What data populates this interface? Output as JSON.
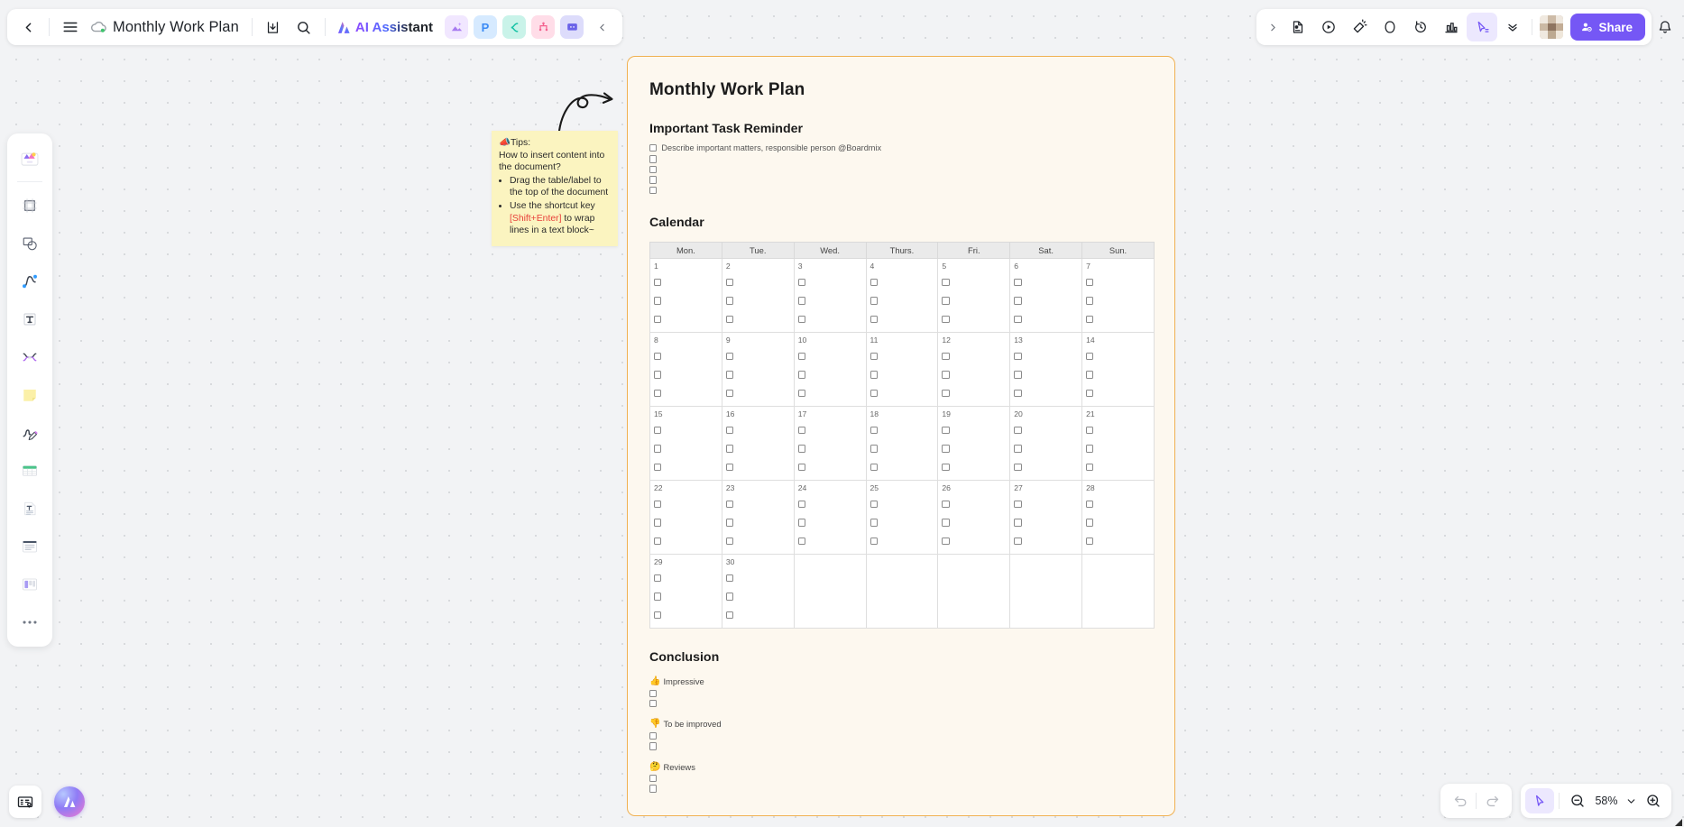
{
  "app": {
    "document_title": "Monthly Work Plan",
    "back_label": "Back",
    "menu_label": "Menu",
    "ai_assistant_label": "AI Assistant",
    "share_label": "Share",
    "app_icons": [
      {
        "name": "ai-image-icon",
        "glyph": "▲",
        "color": "#f0e6ff",
        "fg": "#9b6bf2"
      },
      {
        "name": "ppt-icon",
        "glyph": "P",
        "color": "#d9ecff",
        "fg": "#3b8bf5"
      },
      {
        "name": "mindmap-icon",
        "glyph": "C",
        "color": "#cdf5ec",
        "fg": "#19c2a6"
      },
      {
        "name": "flowchart-icon",
        "glyph": "ᛉ",
        "color": "#ffdfe8",
        "fg": "#f4628f"
      },
      {
        "name": "comment-icon",
        "glyph": "▤",
        "color": "#dcdcfb",
        "fg": "#6a62e8"
      }
    ],
    "right_tools": [
      {
        "name": "sticky-capture-icon",
        "title": "Capture"
      },
      {
        "name": "play-circle-icon",
        "title": "Present"
      },
      {
        "name": "megaphone-icon",
        "title": "Announce"
      },
      {
        "name": "shape-icon",
        "title": "Shape"
      },
      {
        "name": "history-clock-icon",
        "title": "Version history"
      },
      {
        "name": "chart-icon",
        "title": "Chart"
      },
      {
        "name": "cursor-select-icon",
        "title": "Select"
      },
      {
        "name": "chevron-double-down-icon",
        "title": "More"
      }
    ]
  },
  "left_toolbar": {
    "items": [
      {
        "name": "templates-icon",
        "label": "Templates"
      },
      {
        "name": "frame-icon",
        "label": "Frame"
      },
      {
        "name": "shape-icon",
        "label": "Shape"
      },
      {
        "name": "connector-line-icon",
        "label": "Connector"
      },
      {
        "name": "text-icon",
        "label": "Text"
      },
      {
        "name": "mindmap-icon",
        "label": "Mind map"
      },
      {
        "name": "sticky-note-icon",
        "label": "Sticky note"
      },
      {
        "name": "pen-icon",
        "label": "Pen"
      },
      {
        "name": "table-icon",
        "label": "Table"
      },
      {
        "name": "document-icon",
        "label": "Document"
      },
      {
        "name": "list-icon",
        "label": "List"
      },
      {
        "name": "kanban-icon",
        "label": "Kanban"
      },
      {
        "name": "more-icon",
        "label": "More"
      }
    ]
  },
  "tips_note": {
    "heading": "Tips:",
    "emoji": "📣",
    "question": "How to insert content into the document?",
    "bullets_1": "Drag the table/label to the top of the document",
    "bullet_2_pre": "Use the shortcut key ",
    "bullet_2_key": "[Shift+Enter]",
    "bullet_2_post": " to wrap lines in a text block~"
  },
  "document": {
    "title": "Monthly Work Plan",
    "section_task": "Important Task Reminder",
    "task_first_line": "Describe important matters, responsible person @Boardmix",
    "task_blank_count": 4,
    "section_calendar": "Calendar",
    "weekdays": [
      "Mon.",
      "Tue.",
      "Wed.",
      "Thurs.",
      "Fri.",
      "Sat.",
      "Sun."
    ],
    "weeks": [
      [
        {
          "day": "1",
          "checks": 3
        },
        {
          "day": "2",
          "checks": 3
        },
        {
          "day": "3",
          "checks": 3
        },
        {
          "day": "4",
          "checks": 3
        },
        {
          "day": "5",
          "checks": 3
        },
        {
          "day": "6",
          "checks": 3
        },
        {
          "day": "7",
          "checks": 3
        }
      ],
      [
        {
          "day": "8",
          "checks": 3
        },
        {
          "day": "9",
          "checks": 3
        },
        {
          "day": "10",
          "checks": 3
        },
        {
          "day": "11",
          "checks": 3
        },
        {
          "day": "12",
          "checks": 3
        },
        {
          "day": "13",
          "checks": 3
        },
        {
          "day": "14",
          "checks": 3
        }
      ],
      [
        {
          "day": "15",
          "checks": 3
        },
        {
          "day": "16",
          "checks": 3
        },
        {
          "day": "17",
          "checks": 3
        },
        {
          "day": "18",
          "checks": 3
        },
        {
          "day": "19",
          "checks": 3
        },
        {
          "day": "20",
          "checks": 3
        },
        {
          "day": "21",
          "checks": 3
        }
      ],
      [
        {
          "day": "22",
          "checks": 3
        },
        {
          "day": "23",
          "checks": 3
        },
        {
          "day": "24",
          "checks": 3
        },
        {
          "day": "25",
          "checks": 3
        },
        {
          "day": "26",
          "checks": 3
        },
        {
          "day": "27",
          "checks": 3
        },
        {
          "day": "28",
          "checks": 3
        }
      ],
      [
        {
          "day": "29",
          "checks": 3
        },
        {
          "day": "30",
          "checks": 3
        },
        {
          "day": "",
          "checks": 0
        },
        {
          "day": "",
          "checks": 0
        },
        {
          "day": "",
          "checks": 0
        },
        {
          "day": "",
          "checks": 0
        },
        {
          "day": "",
          "checks": 0
        }
      ]
    ],
    "section_conclusion": "Conclusion",
    "conclusion_groups": [
      {
        "emoji": "👍",
        "label": "Impressive",
        "checks": 2
      },
      {
        "emoji": "👎",
        "label": "To be improved",
        "checks": 2
      },
      {
        "emoji": "🤔",
        "label": "Reviews",
        "checks": 2
      }
    ]
  },
  "bottom": {
    "minimap_label": "Minimap",
    "ai_label": "AI",
    "undo_label": "Undo",
    "redo_label": "Redo",
    "cursor_label": "Select",
    "zoom_out_label": "Zoom out",
    "zoom_in_label": "Zoom in",
    "zoom_value": "58%"
  },
  "colors": {
    "accent": "#7557f5",
    "doc_border": "#f0b152",
    "doc_bg": "#fdf8ef",
    "note_bg": "#fbf4c0",
    "key_red": "#e8403a"
  }
}
